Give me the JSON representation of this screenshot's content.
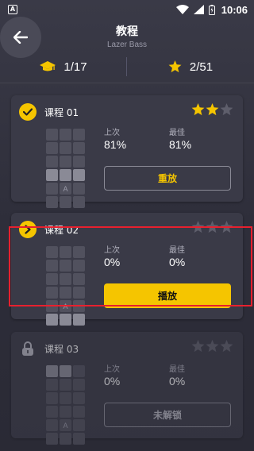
{
  "status_bar": {
    "notification_badge": "A",
    "time": "10:06"
  },
  "header": {
    "title": "教程",
    "subtitle": "Lazer Bass"
  },
  "summary": {
    "lessons_completed": "1/17",
    "stars_earned": "2/51"
  },
  "colors": {
    "accent": "#f5c500",
    "card_bg": "#3a3a47",
    "highlight": "#e8202e"
  },
  "lessons": [
    {
      "name": "课程 01",
      "status": "completed",
      "stars_filled": 2,
      "stars_total": 3,
      "grid_label": "A",
      "last_label": "上次",
      "last_value": "81%",
      "best_label": "最佳",
      "best_value": "81%",
      "action_label": "重放"
    },
    {
      "name": "课程 02",
      "status": "current",
      "stars_filled": 0,
      "stars_total": 3,
      "grid_label": "A",
      "last_label": "上次",
      "last_value": "0%",
      "best_label": "最佳",
      "best_value": "0%",
      "action_label": "播放"
    },
    {
      "name": "课程 03",
      "status": "locked",
      "stars_filled": 0,
      "stars_total": 3,
      "grid_label": "A",
      "last_label": "上次",
      "last_value": "0%",
      "best_label": "最佳",
      "best_value": "0%",
      "action_label": "未解锁"
    }
  ]
}
